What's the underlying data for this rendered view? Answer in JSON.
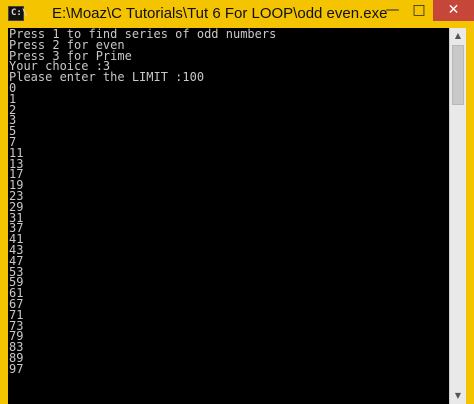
{
  "window": {
    "title": "E:\\Moaz\\C Tutorials\\Tut 6 For LOOP\\odd even.exe",
    "icon_text": "C:\\",
    "buttons": {
      "minimize": "—",
      "maximize": "□",
      "close": "✕"
    }
  },
  "console": {
    "lines": [
      "Press 1 to find series of odd numbers",
      "Press 2 for even",
      "Press 3 for Prime",
      "Your choice :3",
      "Please enter the LIMIT :100",
      "0",
      "1",
      "2",
      "3",
      "5",
      "7",
      "11",
      "13",
      "17",
      "19",
      "23",
      "29",
      "31",
      "37",
      "41",
      "43",
      "47",
      "53",
      "59",
      "61",
      "67",
      "71",
      "73",
      "79",
      "83",
      "89",
      "97"
    ],
    "text_color": "#c8c8c8",
    "background": "#000000"
  },
  "colors": {
    "frame": "#f5c400",
    "close_button": "#c7463a"
  },
  "icons": {
    "window_icon": "console-icon",
    "scroll_up": "scroll-up-arrow-icon",
    "scroll_down": "scroll-down-arrow-icon"
  }
}
